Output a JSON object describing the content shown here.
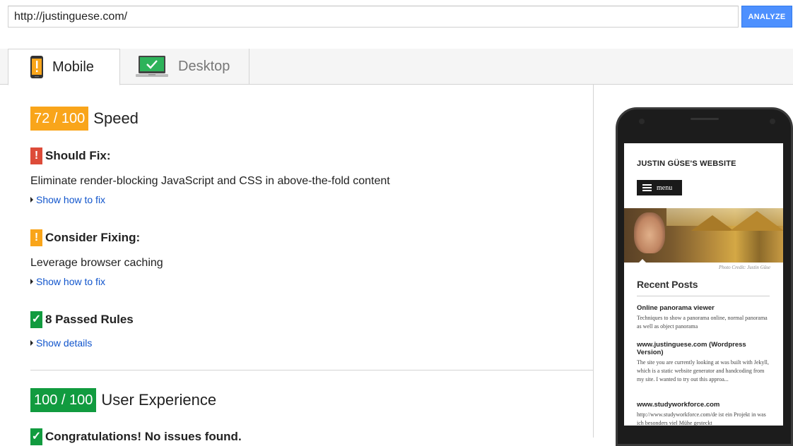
{
  "url_bar": {
    "value": "http://justinguese.com/",
    "analyze_label": "ANALYZE"
  },
  "tabs": [
    {
      "label": "Mobile",
      "icon": "mobile-warning-icon",
      "active": true
    },
    {
      "label": "Desktop",
      "icon": "desktop-check-icon",
      "active": false
    }
  ],
  "speed": {
    "score": "72 / 100",
    "title": "Speed",
    "color": "#f9a51a",
    "should_fix": {
      "heading": "Should Fix:",
      "icon": "!",
      "rule": "Eliminate render-blocking JavaScript and CSS in above-the-fold content",
      "link": "Show how to fix"
    },
    "consider_fixing": {
      "heading": "Consider Fixing:",
      "icon": "!",
      "rule": "Leverage browser caching",
      "link": "Show how to fix"
    },
    "passed": {
      "heading": "8 Passed Rules",
      "icon": "✓",
      "link": "Show details"
    }
  },
  "ux": {
    "score": "100 / 100",
    "title": "User Experience",
    "color": "#119b3f",
    "congrats": {
      "icon": "✓",
      "heading": "Congratulations! No issues found."
    }
  },
  "preview": {
    "site_title": "JUSTIN GÜSE'S WEBSITE",
    "menu_label": "menu",
    "photo_credit": "Photo Credit: Justin Güse",
    "recent_heading": "Recent Posts",
    "posts": [
      {
        "title": "Online panorama viewer",
        "excerpt": "Techniques to show a panorama online, normal panorama as well as object panorama"
      },
      {
        "title": "www.justinguese.com (Wordpress Version)",
        "excerpt": "The site you are currently looking at was built with Jekyll, which is a static website generator and handcoding from my site. I wanted to try out this approa..."
      },
      {
        "title": "www.studyworkforce.com",
        "excerpt": "http://www.studyworkforce.com/de ist ein Projekt in was ich besonders viel Mühe gesteckt"
      }
    ]
  }
}
